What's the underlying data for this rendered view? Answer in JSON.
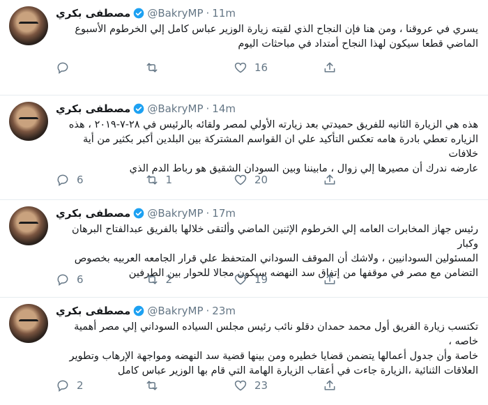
{
  "colors": {
    "accent": "#1da1f2",
    "text": "#14171a",
    "muted": "#657786",
    "border": "#e6ecf0"
  },
  "icons": {
    "reply": "speech-bubble-icon",
    "retweet": "retweet-arrows-icon",
    "like": "heart-icon",
    "share": "share-upload-icon",
    "verified": "verified-badge-icon"
  },
  "tweets": [
    {
      "name": "مصطفى بكري",
      "handle": "@BakryMP",
      "time": "11m",
      "lines": [
        "يسري في عروقنا ، ومن هنا فإن النجاح الذي لقيته زيارة الوزير عباس كامل إلي الخرطوم الأسبوع",
        "الماضي قطعا سيكون لهذا النجاح أمتداد في مباحثات اليوم"
      ],
      "replies": "",
      "retweets": "",
      "likes": "16"
    },
    {
      "name": "مصطفى بكري",
      "handle": "@BakryMP",
      "time": "14m",
      "lines": [
        "هذه هي الزيارة الثانيه للفريق حميدتي بعد زيارته الأولي لمصر ولقائه بالرئيس في ٢٨-٧-٢٠١٩ ، هذه",
        "الزياره تعطي بادرة هامه تعكس التأكيد علي ان القواسم المشتركة بين البلدين أكبر بكثير من أية خلافات",
        "عارضه ندرك أن مصيرها إلي زوال ، مابيننا وبين السودان الشقيق هو رباط الدم الذي"
      ],
      "replies": "6",
      "retweets": "1",
      "likes": "20"
    },
    {
      "name": "مصطفى بكري",
      "handle": "@BakryMP",
      "time": "17m",
      "lines": [
        "رئيس جهاز المخابرات العامه إلي الخرطوم الإثنين الماضي وألتقى خلالها بالفريق عبدالفتاح البرهان وكبار",
        "المسئولين السودانيين ، ولاشك أن الموقف السوداني المتحفظ علي قرار الجامعه العربيه بخصوص",
        "التضامن مع مصر في موقفها من إتفاق سد النهضه سيكون مجالا للحوار بين الطرفين"
      ],
      "replies": "6",
      "retweets": "2",
      "likes": "19"
    },
    {
      "name": "مصطفى بكري",
      "handle": "@BakryMP",
      "time": "23m",
      "lines": [
        "تكتسب زيارة الفريق أول محمد حمدان دقلو نائب رئيس مجلس السياده السوداني إلي مصر أهمية خاصه ،",
        "خاصة وأن جدول أعمالها يتضمن قضايا خطيره ومن بينها قضية سد النهضه ومواجهة الإرهاب وتطوير",
        "العلاقات الثنائية ،الزيارة جاءت في أعقاب الزيارة الهامة التي قام بها الوزير عباس كامل"
      ],
      "replies": "2",
      "retweets": "",
      "likes": "23"
    }
  ]
}
